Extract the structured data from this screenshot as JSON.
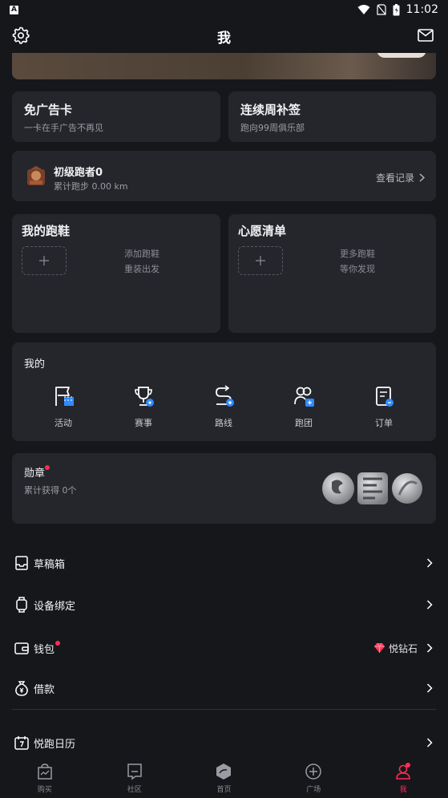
{
  "status": {
    "time": "11:02",
    "app_glyph": "A"
  },
  "header": {
    "title": "我"
  },
  "promos": [
    {
      "title": "免广告卡",
      "subtitle": "一卡在手广告不再见"
    },
    {
      "title": "连续周补签",
      "subtitle": "跑向99周俱乐部"
    }
  ],
  "runner": {
    "level": "初级跑者0",
    "distance": "累计跑步 0.00 km",
    "link": "查看记录"
  },
  "shoes": {
    "title": "我的跑鞋",
    "hint_line1": "添加跑鞋",
    "hint_line2": "重装出发"
  },
  "wishlist": {
    "title": "心愿清单",
    "hint_line1": "更多跑鞋",
    "hint_line2": "等你发现"
  },
  "mine": {
    "title": "我的",
    "items": [
      {
        "label": "活动",
        "icon": "activity-flag-icon"
      },
      {
        "label": "赛事",
        "icon": "trophy-icon"
      },
      {
        "label": "路线",
        "icon": "route-icon"
      },
      {
        "label": "跑团",
        "icon": "group-icon"
      },
      {
        "label": "订单",
        "icon": "order-icon"
      }
    ]
  },
  "badges": {
    "title": "勋章",
    "subtitle": "累计获得 0个"
  },
  "menu": {
    "drafts": "草稿箱",
    "device": "设备绑定",
    "wallet": "钱包",
    "wallet_right": "悦钻石",
    "loan": "借款",
    "calendar": "悦跑日历"
  },
  "nav": [
    {
      "label": "购买"
    },
    {
      "label": "社区"
    },
    {
      "label": "首页"
    },
    {
      "label": "广场"
    },
    {
      "label": "我"
    }
  ],
  "colors": {
    "background": "#16171b",
    "card": "#24262b",
    "accent": "#ff2d55",
    "icon_blue": "#2f8cff"
  }
}
